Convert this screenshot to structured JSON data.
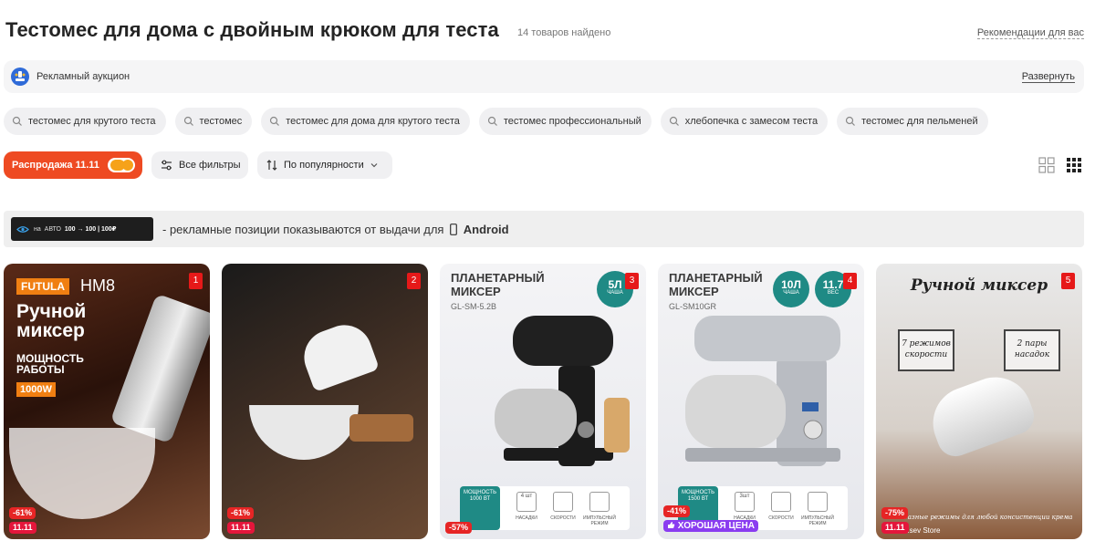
{
  "header": {
    "title": "Тестомес для дома с двойным крюком для теста",
    "found": "14 товаров найдено",
    "recommendations": "Рекомендации для вас"
  },
  "ad_bar": {
    "label": "Рекламный аукцион",
    "expand": "Развернуть"
  },
  "chips": [
    "тестомес для крутого теста",
    "тестомес",
    "тестомес для дома для крутого теста",
    "тестомес профессиональный",
    "хлебопечка с замесом теста",
    "тестомес для пельменей"
  ],
  "controls": {
    "sale": "Распродажа 11.11",
    "sale_toggle_on": true,
    "filters": "Все фильтры",
    "sort": "По популярности"
  },
  "ad_notice": {
    "badge_prefix": "на",
    "badge_auto": "АВТО",
    "badge_value": "100 → 100 | 100₽",
    "text": "- рекламные позиции показываются от выдачи для",
    "platform": "Android"
  },
  "cards": [
    {
      "position": "1",
      "brand": "FUTULA",
      "model": "HM8",
      "headline": "Ручной миксер",
      "subline": "МОЩНОСТЬ РАБОТЫ",
      "power": "1000W",
      "discount": "-61%",
      "sale_tag": "11.11"
    },
    {
      "position": "2",
      "discount": "-61%",
      "sale_tag": "11.11"
    },
    {
      "position": "3",
      "title": "ПЛАНЕТАРНЫЙ МИКСЕР",
      "model": "GL-SM-5.2B",
      "volume": "5Л",
      "volume_unit": "ЧАША",
      "feature_power": "МОЩНОСТЬ 1000 ВТ",
      "feature_labels": [
        "НАСАДКИ",
        "СКОРОСТИ",
        "ИМПУЛЬСНЫЙ РЕЖИМ"
      ],
      "feature_count": "4 шт",
      "discount": "-57%"
    },
    {
      "position": "4",
      "title": "ПЛАНЕТАРНЫЙ МИКСЕР",
      "model": "GL-SM10GR",
      "volume": "10Л",
      "volume_unit": "ЧАША",
      "weight": "11.7",
      "weight_unit": "ВЕС",
      "feature_power": "МОЩНОСТЬ 1500 ВТ",
      "feature_labels": [
        "НАСАДКИ",
        "СКОРОСТИ",
        "ИМПУЛЬСНЫЙ РЕЖИМ"
      ],
      "feature_count": "3шт",
      "discount": "-41%",
      "good_price": "ХОРОШАЯ ЦЕНА"
    },
    {
      "position": "5",
      "title": "Ручной миксер",
      "box_left": "7 режимов скорости",
      "box_right": "2 пары насадок",
      "caption": "Разные режимы для любой консистенции крема",
      "store": "...sev Store",
      "discount": "-75%",
      "sale_tag": "11.11"
    }
  ],
  "colors": {
    "accent": "#ee4a22",
    "toggle": "#f6a21a",
    "position_badge": "#e61919",
    "teal": "#1f8a85",
    "good_price": "#8a3cf0"
  }
}
